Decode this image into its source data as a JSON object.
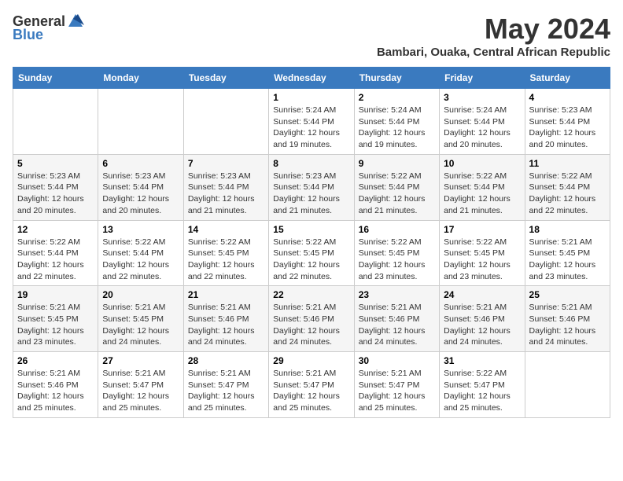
{
  "logo": {
    "general": "General",
    "blue": "Blue"
  },
  "title": "May 2024",
  "location": "Bambari, Ouaka, Central African Republic",
  "days_of_week": [
    "Sunday",
    "Monday",
    "Tuesday",
    "Wednesday",
    "Thursday",
    "Friday",
    "Saturday"
  ],
  "weeks": [
    [
      {
        "day": "",
        "info": ""
      },
      {
        "day": "",
        "info": ""
      },
      {
        "day": "",
        "info": ""
      },
      {
        "day": "1",
        "info": "Sunrise: 5:24 AM\nSunset: 5:44 PM\nDaylight: 12 hours\nand 19 minutes."
      },
      {
        "day": "2",
        "info": "Sunrise: 5:24 AM\nSunset: 5:44 PM\nDaylight: 12 hours\nand 19 minutes."
      },
      {
        "day": "3",
        "info": "Sunrise: 5:24 AM\nSunset: 5:44 PM\nDaylight: 12 hours\nand 20 minutes."
      },
      {
        "day": "4",
        "info": "Sunrise: 5:23 AM\nSunset: 5:44 PM\nDaylight: 12 hours\nand 20 minutes."
      }
    ],
    [
      {
        "day": "5",
        "info": "Sunrise: 5:23 AM\nSunset: 5:44 PM\nDaylight: 12 hours\nand 20 minutes."
      },
      {
        "day": "6",
        "info": "Sunrise: 5:23 AM\nSunset: 5:44 PM\nDaylight: 12 hours\nand 20 minutes."
      },
      {
        "day": "7",
        "info": "Sunrise: 5:23 AM\nSunset: 5:44 PM\nDaylight: 12 hours\nand 21 minutes."
      },
      {
        "day": "8",
        "info": "Sunrise: 5:23 AM\nSunset: 5:44 PM\nDaylight: 12 hours\nand 21 minutes."
      },
      {
        "day": "9",
        "info": "Sunrise: 5:22 AM\nSunset: 5:44 PM\nDaylight: 12 hours\nand 21 minutes."
      },
      {
        "day": "10",
        "info": "Sunrise: 5:22 AM\nSunset: 5:44 PM\nDaylight: 12 hours\nand 21 minutes."
      },
      {
        "day": "11",
        "info": "Sunrise: 5:22 AM\nSunset: 5:44 PM\nDaylight: 12 hours\nand 22 minutes."
      }
    ],
    [
      {
        "day": "12",
        "info": "Sunrise: 5:22 AM\nSunset: 5:44 PM\nDaylight: 12 hours\nand 22 minutes."
      },
      {
        "day": "13",
        "info": "Sunrise: 5:22 AM\nSunset: 5:44 PM\nDaylight: 12 hours\nand 22 minutes."
      },
      {
        "day": "14",
        "info": "Sunrise: 5:22 AM\nSunset: 5:45 PM\nDaylight: 12 hours\nand 22 minutes."
      },
      {
        "day": "15",
        "info": "Sunrise: 5:22 AM\nSunset: 5:45 PM\nDaylight: 12 hours\nand 22 minutes."
      },
      {
        "day": "16",
        "info": "Sunrise: 5:22 AM\nSunset: 5:45 PM\nDaylight: 12 hours\nand 23 minutes."
      },
      {
        "day": "17",
        "info": "Sunrise: 5:22 AM\nSunset: 5:45 PM\nDaylight: 12 hours\nand 23 minutes."
      },
      {
        "day": "18",
        "info": "Sunrise: 5:21 AM\nSunset: 5:45 PM\nDaylight: 12 hours\nand 23 minutes."
      }
    ],
    [
      {
        "day": "19",
        "info": "Sunrise: 5:21 AM\nSunset: 5:45 PM\nDaylight: 12 hours\nand 23 minutes."
      },
      {
        "day": "20",
        "info": "Sunrise: 5:21 AM\nSunset: 5:45 PM\nDaylight: 12 hours\nand 24 minutes."
      },
      {
        "day": "21",
        "info": "Sunrise: 5:21 AM\nSunset: 5:46 PM\nDaylight: 12 hours\nand 24 minutes."
      },
      {
        "day": "22",
        "info": "Sunrise: 5:21 AM\nSunset: 5:46 PM\nDaylight: 12 hours\nand 24 minutes."
      },
      {
        "day": "23",
        "info": "Sunrise: 5:21 AM\nSunset: 5:46 PM\nDaylight: 12 hours\nand 24 minutes."
      },
      {
        "day": "24",
        "info": "Sunrise: 5:21 AM\nSunset: 5:46 PM\nDaylight: 12 hours\nand 24 minutes."
      },
      {
        "day": "25",
        "info": "Sunrise: 5:21 AM\nSunset: 5:46 PM\nDaylight: 12 hours\nand 24 minutes."
      }
    ],
    [
      {
        "day": "26",
        "info": "Sunrise: 5:21 AM\nSunset: 5:46 PM\nDaylight: 12 hours\nand 25 minutes."
      },
      {
        "day": "27",
        "info": "Sunrise: 5:21 AM\nSunset: 5:47 PM\nDaylight: 12 hours\nand 25 minutes."
      },
      {
        "day": "28",
        "info": "Sunrise: 5:21 AM\nSunset: 5:47 PM\nDaylight: 12 hours\nand 25 minutes."
      },
      {
        "day": "29",
        "info": "Sunrise: 5:21 AM\nSunset: 5:47 PM\nDaylight: 12 hours\nand 25 minutes."
      },
      {
        "day": "30",
        "info": "Sunrise: 5:21 AM\nSunset: 5:47 PM\nDaylight: 12 hours\nand 25 minutes."
      },
      {
        "day": "31",
        "info": "Sunrise: 5:22 AM\nSunset: 5:47 PM\nDaylight: 12 hours\nand 25 minutes."
      },
      {
        "day": "",
        "info": ""
      }
    ]
  ]
}
